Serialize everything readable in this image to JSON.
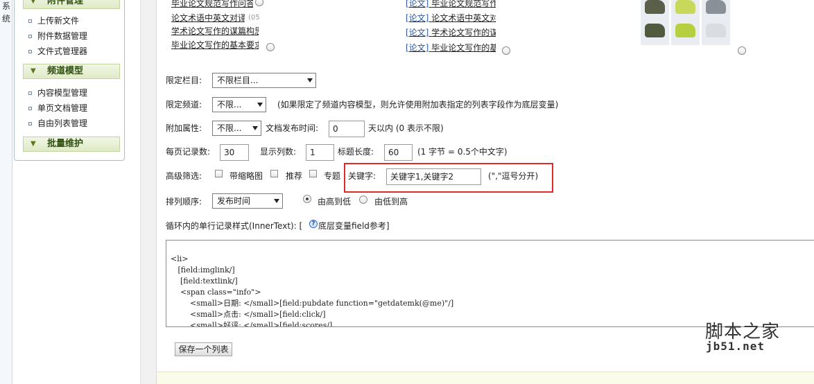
{
  "sidebar": {
    "vertical_tab": "系统",
    "section_top": "附件管理",
    "attach_items": [
      "上传新文件",
      "附件数据管理",
      "文件式管理器"
    ],
    "section_channel": "频道模型",
    "channel_items": [
      "内容模型管理",
      "单页文档管理",
      "自由列表管理"
    ],
    "section_batch": "批量维护"
  },
  "preview": {
    "col1": [
      "毕业论文规范写作问答",
      "论文术语中英文对译",
      "学术论文写作的谋篇构思",
      "毕业论文写作的基本要求"
    ],
    "col1_date": "(05",
    "col2_tag": "[论文]",
    "col2": [
      "毕业论文规范写作问",
      "论文术语中英文对译",
      "学术论文写作的谋篇",
      "毕业论文写作的基本"
    ]
  },
  "form": {
    "column_label": "限定栏目:",
    "column_value": "不限栏目...",
    "channel_label": "限定频道:",
    "channel_value": "不限...",
    "channel_note": "(如果限定了频道内容模型，则允许使用附加表指定的列表字段作为底层变量)",
    "attr_label": "附加属性:",
    "attr_value": "不限...",
    "pubtime_label": "文档发布时间:",
    "pubtime_value": "0",
    "pubtime_unit": "天以内 (0 表示不限)",
    "perpage_label": "每页记录数:",
    "perpage_value": "30",
    "cols_label": "显示列数:",
    "cols_value": "1",
    "titlelen_label": "标题长度:",
    "titlelen_value": "60",
    "titlelen_note": "(1 字节 = 0.5个中文字)",
    "adv_label": "高级筛选:",
    "thumb_label": "带缩略图",
    "recommend_label": "推荐",
    "topic_label": "专题",
    "keyword_label": "关键字:",
    "keyword_value": "关键字1,关键字2",
    "keyword_note": "(\",\"逗号分开)",
    "order_label": "排列顺序:",
    "order_value": "发布时间",
    "order_desc": "由高到低",
    "order_asc": "由低到高",
    "innertext_label": "循环内的单行记录样式(InnerText): [",
    "innertext_link": "底层变量field参考]"
  },
  "code_lines": [
    "<li>",
    "   [field:imglink/]",
    "    [field:textlink/]",
    "    <span class=\"info\">",
    "        <small>日期: </small>[field:pubdate function=\"getdatemk(@me)\"/]",
    "        <small>点击: </small>[field:click/]",
    "        <small>好评: </small>[field:scores/]"
  ],
  "save_button": "保存一个列表",
  "watermark": {
    "cn": "脚本之家",
    "url": "jb51.net"
  }
}
